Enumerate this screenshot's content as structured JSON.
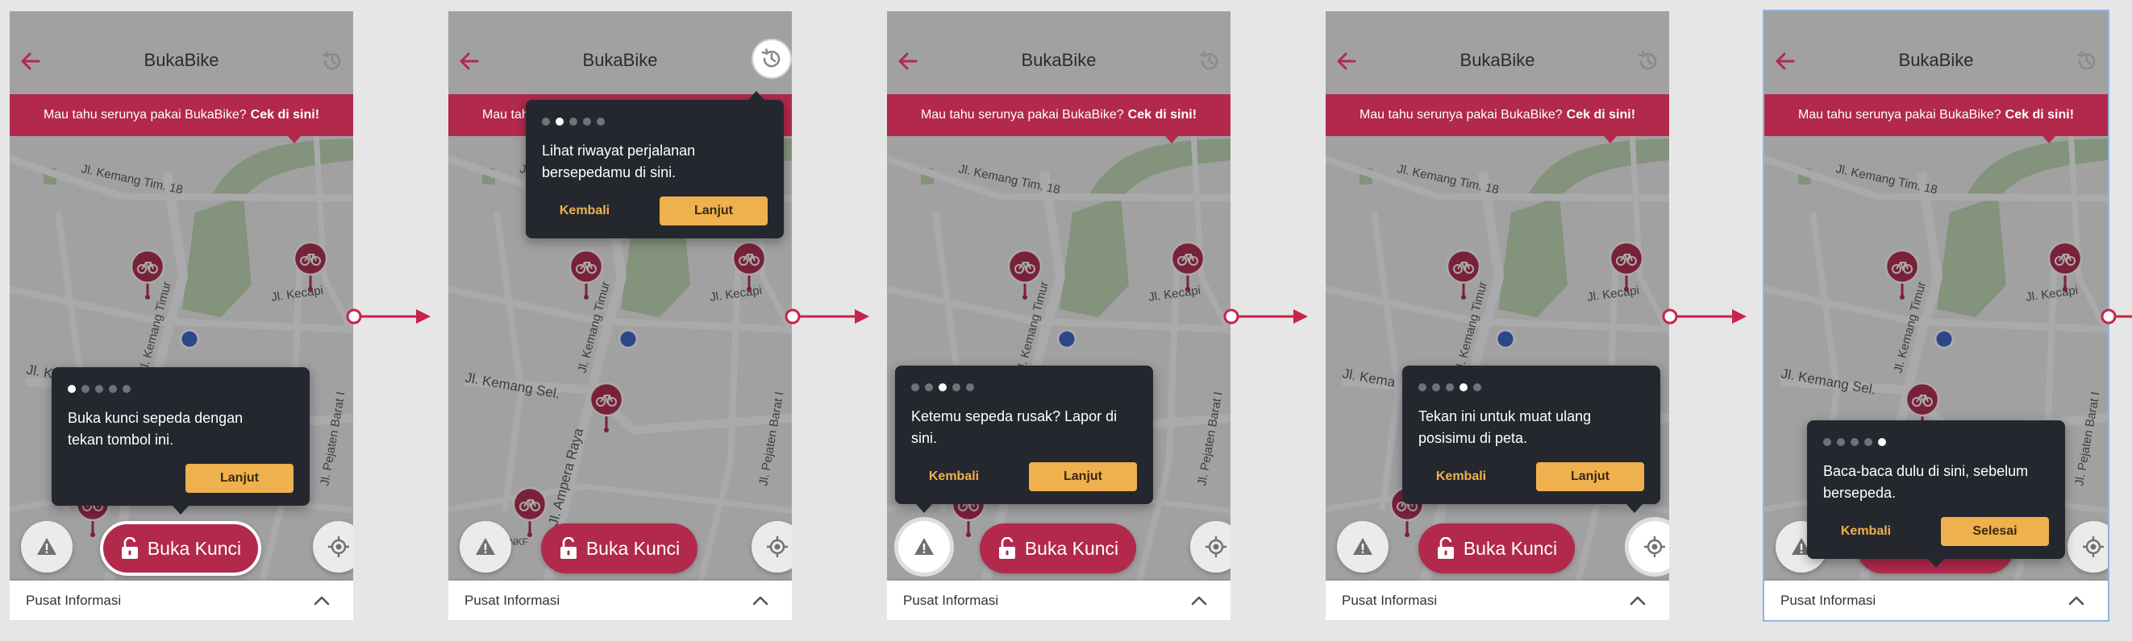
{
  "app": {
    "title": "BukaBike",
    "banner_text": "Mau tahu serunya pakai BukaBike?",
    "banner_link": "Cek di sini!",
    "unlock_label": "Buka Kunci",
    "info_label": "Pusat Informasi",
    "streets": [
      "Jl. Kemang Tim. 18",
      "Jl. Kemang Timur",
      "Jl. Kecapi",
      "Jl. Kemang Sel.",
      "Jl. Ampera Raya",
      "Jl. Pejaten Barat I",
      "NKF"
    ]
  },
  "colors": {
    "brand": "#b2294c",
    "tooltip": "#24272e",
    "accent": "#efb14d",
    "location": "#3b63c9"
  },
  "icons": {
    "back": "arrow-left-icon",
    "history": "history-icon",
    "report": "warning-icon",
    "locate": "crosshair-icon",
    "unlock": "unlock-icon",
    "chevron": "chevron-up-icon",
    "bike_pin": "bike-pin-icon"
  },
  "steps": [
    {
      "step": 1,
      "total": 5,
      "text": "Buka kunci sepeda dengan tekan tombol ini.",
      "back_label": "",
      "next_label": "Lanjut",
      "highlight": "unlock-button"
    },
    {
      "step": 2,
      "total": 5,
      "text": "Lihat riwayat perjalanan bersepedamu di sini.",
      "back_label": "Kembali",
      "next_label": "Lanjut",
      "highlight": "history-button"
    },
    {
      "step": 3,
      "total": 5,
      "text": "Ketemu sepeda rusak? Lapor di sini.",
      "back_label": "Kembali",
      "next_label": "Lanjut",
      "highlight": "report-button"
    },
    {
      "step": 4,
      "total": 5,
      "text": "Tekan ini untuk muat ulang posisimu di peta.",
      "back_label": "Kembali",
      "next_label": "Lanjut",
      "highlight": "locate-button"
    },
    {
      "step": 5,
      "total": 5,
      "text": "Baca-baca dulu di sini, sebelum bersepeda.",
      "back_label": "Kembali",
      "next_label": "Selesai",
      "highlight": "info-bar"
    }
  ]
}
